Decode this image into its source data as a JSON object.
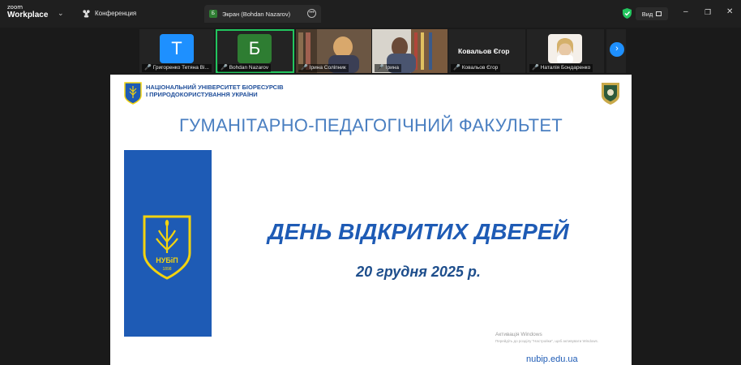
{
  "titlebar": {
    "logo_top": "zoom",
    "logo_bottom": "Workplace",
    "conference_label": "Конференция",
    "tab_label": "Экран (Bohdan Nazarov)",
    "tab_icon_letter": "Б",
    "view_label": "Вид"
  },
  "participants": [
    {
      "name": "Григоренко Тетяна Ві...",
      "initial": "Т",
      "color": "#1e90ff"
    },
    {
      "name": "Bohdan Nazarov",
      "initial": "Б",
      "color": "#2e7d32",
      "active": true
    },
    {
      "name": "Ірина Соліпник"
    },
    {
      "name": "Ірина"
    },
    {
      "name": "Ковальов Єгор",
      "display": "Ковальов Єгор"
    },
    {
      "name": "Наталія Бондаренко"
    }
  ],
  "slide": {
    "university_line1": "НАЦІОНАЛЬНИЙ УНІВЕРСИТЕТ БІОРЕСУРСІВ",
    "university_line2": "І ПРИРОДОКОРИСТУВАННЯ УКРАЇНИ",
    "faculty": "ГУМАНІТАРНО-ПЕДАГОГІЧНИЙ ФАКУЛЬТЕТ",
    "title": "ДЕНЬ ВІДКРИТИХ ДВЕРЕЙ",
    "date": "20 грудня 2025 р.",
    "logo_text": "НУБіП",
    "logo_year": "1898",
    "watermark_title": "Активація Windows",
    "watermark_sub": "Перейдіть до розділу \"Настройки\", щоб активувати Windows.",
    "url": "nubip.edu.ua"
  },
  "colors": {
    "brand_blue": "#1e5bb5",
    "faculty_blue": "#4a7fc1",
    "active_border": "#22c55e",
    "emblem_yellow": "#f2d30f"
  }
}
